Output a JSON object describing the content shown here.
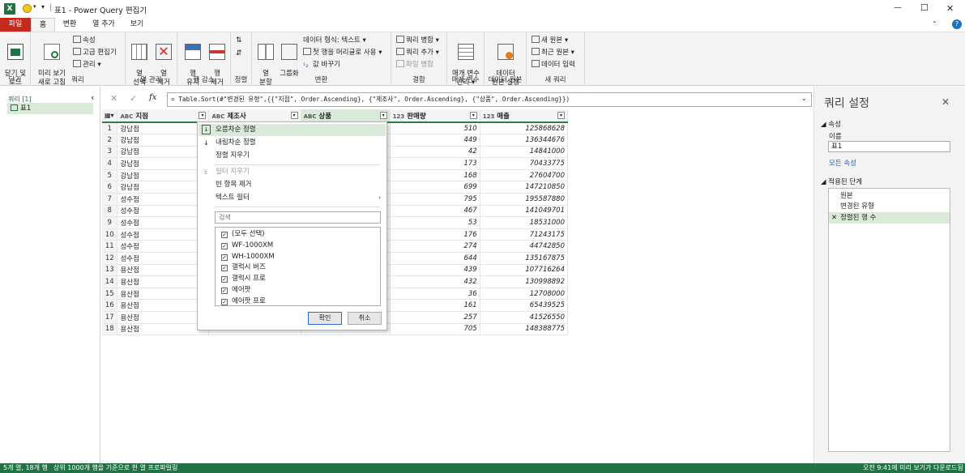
{
  "window": {
    "title": "표1 - Power Query 편집기",
    "qat_sep": "|",
    "min_glyph": "—",
    "max_glyph": "☐",
    "close_glyph": "✕"
  },
  "tabs": [
    "파일",
    "홈",
    "변환",
    "열 추가",
    "보기"
  ],
  "ribbon": {
    "close": {
      "btn": "닫기 및\n로드",
      "label": "닫기"
    },
    "query": {
      "refresh": "미리 보기\n새로 고침",
      "props": "속성",
      "adv": "고급 편집기",
      "manage": "관리",
      "label": "쿼리"
    },
    "cols": {
      "select": "열\n선택",
      "remove": "열\n제거",
      "label": "열 관리"
    },
    "rows": {
      "keep": "행\n유지",
      "remove": "행\n제거",
      "label": "행 감소"
    },
    "sort": {
      "label": "정렬"
    },
    "transform": {
      "split": "열\n분할",
      "group": "그룹화",
      "dtype": "데이터 형식: 텍스트",
      "header": "첫 행을 머리글로 사용",
      "replace": "값 바꾸기",
      "label": "변환"
    },
    "combine": {
      "merge": "쿼리 병합",
      "append": "쿼리 추가",
      "files": "파일 병합",
      "label": "결합"
    },
    "params": {
      "manage": "매개 변수\n관리",
      "label": "매개 변수"
    },
    "datasource": {
      "settings": "데이터\n원본 설정",
      "label": "데이터 원본"
    },
    "newq": {
      "new": "새 원본",
      "recent": "최근 원본",
      "enter": "데이터 입력",
      "label": "새 쿼리"
    }
  },
  "queries": {
    "header": "쿼리 [1]",
    "items": [
      "표1"
    ]
  },
  "formula": {
    "text": "= Table.Sort(#\"변경된 유형\",{{\"지점\", Order.Ascending}, {\"제조사\", Order.Ascending}, {\"상품\", Order.Ascending}})",
    "fx": "fx"
  },
  "grid": {
    "columns": [
      {
        "type": "ABC",
        "name": "지점"
      },
      {
        "type": "ABC",
        "name": "제조사"
      },
      {
        "type": "ABC",
        "name": "상품"
      },
      {
        "type": "123",
        "name": "판매량"
      },
      {
        "type": "123",
        "name": "매출"
      }
    ],
    "rows": [
      [
        "1",
        "강남점",
        "",
        "",
        "510",
        "125868628"
      ],
      [
        "2",
        "강남점",
        "",
        "",
        "449",
        "136344676"
      ],
      [
        "3",
        "강남점",
        "",
        "",
        "42",
        "14841000"
      ],
      [
        "4",
        "강남점",
        "",
        "",
        "173",
        "70433775"
      ],
      [
        "5",
        "강남점",
        "",
        "",
        "168",
        "27604700"
      ],
      [
        "6",
        "강남점",
        "",
        "",
        "699",
        "147210850"
      ],
      [
        "7",
        "성수점",
        "",
        "",
        "795",
        "195587880"
      ],
      [
        "8",
        "성수점",
        "",
        "",
        "467",
        "141049701"
      ],
      [
        "9",
        "성수점",
        "",
        "",
        "53",
        "18531000"
      ],
      [
        "10",
        "성수점",
        "",
        "",
        "176",
        "71243175"
      ],
      [
        "11",
        "성수점",
        "",
        "",
        "274",
        "44742850"
      ],
      [
        "12",
        "성수점",
        "",
        "",
        "644",
        "135167875"
      ],
      [
        "13",
        "용산점",
        "",
        "",
        "439",
        "107716264"
      ],
      [
        "14",
        "용산점",
        "",
        "",
        "432",
        "130998892"
      ],
      [
        "15",
        "용산점",
        "",
        "",
        "36",
        "12708000"
      ],
      [
        "16",
        "용산점",
        "",
        "",
        "161",
        "65439525"
      ],
      [
        "17",
        "용산점",
        "",
        "",
        "257",
        "41526550"
      ],
      [
        "18",
        "용산점",
        "",
        "",
        "705",
        "148388775"
      ]
    ]
  },
  "filter_menu": {
    "sort_asc": "오름차순 정렬",
    "sort_desc": "내림차순 정렬",
    "clear_sort": "정렬 지우기",
    "clear_filter": "필터 지우기",
    "remove_empty": "빈 항목 제거",
    "text_filter": "텍스트 필터",
    "search_placeholder": "검색",
    "values": [
      "(모두 선택)",
      "WF-1000XM",
      "WH-1000XM",
      "갤럭시 버즈",
      "갤럭시 프로",
      "에어팟",
      "에어팟 프로"
    ],
    "ok": "확인",
    "cancel": "취소"
  },
  "settings": {
    "title": "쿼리 설정",
    "props_header": "속성",
    "name_label": "이름",
    "name_value": "표1",
    "all_props": "모든 속성",
    "steps_header": "적용된 단계",
    "steps": [
      "원본",
      "변경된 유형",
      "정렬된 행 수"
    ]
  },
  "status": {
    "left": "5개 열, 18개 행",
    "profile": "상위 1000개 행을 기준으로 한 열 프로파일링",
    "right": "오전 9:41에 미리 보기가 다운로드됨"
  },
  "colors": {
    "accent": "#217346",
    "file_tab": "#c42b1c",
    "selected": "#d9ead9"
  }
}
